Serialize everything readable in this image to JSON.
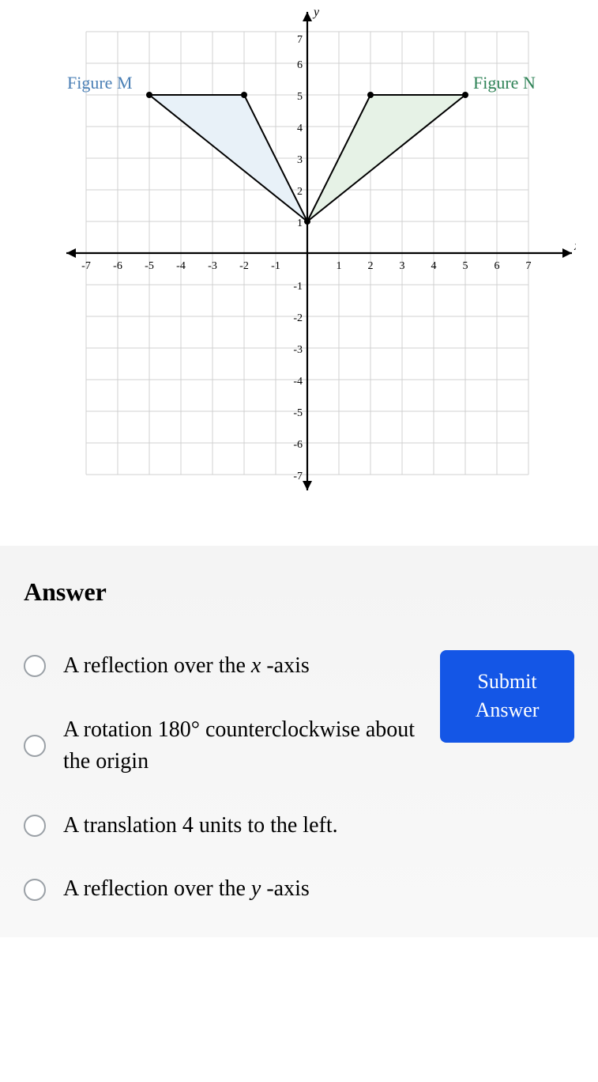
{
  "chart_data": {
    "type": "scatter",
    "title": "",
    "xlabel": "x",
    "ylabel": "y",
    "xlim": [
      -7,
      7
    ],
    "ylim": [
      -7,
      7
    ],
    "x_ticks": [
      -7,
      -6,
      -5,
      -4,
      -3,
      -2,
      -1,
      1,
      2,
      3,
      4,
      5,
      6,
      7
    ],
    "y_ticks": [
      -7,
      -6,
      -5,
      -4,
      -3,
      -2,
      -1,
      1,
      2,
      3,
      4,
      5,
      6,
      7
    ],
    "figures": [
      {
        "name": "Figure M",
        "label_color": "#4a7fb5",
        "fill": "#e8f1f8",
        "vertices": [
          [
            -5,
            5
          ],
          [
            -2,
            5
          ],
          [
            0,
            1
          ]
        ]
      },
      {
        "name": "Figure N",
        "label_color": "#2e8256",
        "fill": "#e6f2e6",
        "vertices": [
          [
            5,
            5
          ],
          [
            2,
            5
          ],
          [
            0,
            1
          ]
        ]
      }
    ]
  },
  "answer": {
    "heading": "Answer",
    "options": [
      {
        "pre": "A reflection over the ",
        "var": "x",
        "post": " -axis"
      },
      {
        "pre": "A rotation 180° counterclockwise about the origin",
        "var": "",
        "post": ""
      },
      {
        "pre": "A translation 4 units to the left.",
        "var": "",
        "post": ""
      },
      {
        "pre": "A reflection over the ",
        "var": "y",
        "post": " -axis"
      }
    ],
    "submit_label": "Submit Answer"
  },
  "labels": {
    "figure_m": "Figure M",
    "figure_n": "Figure N",
    "x_axis": "x",
    "y_axis": "y"
  }
}
